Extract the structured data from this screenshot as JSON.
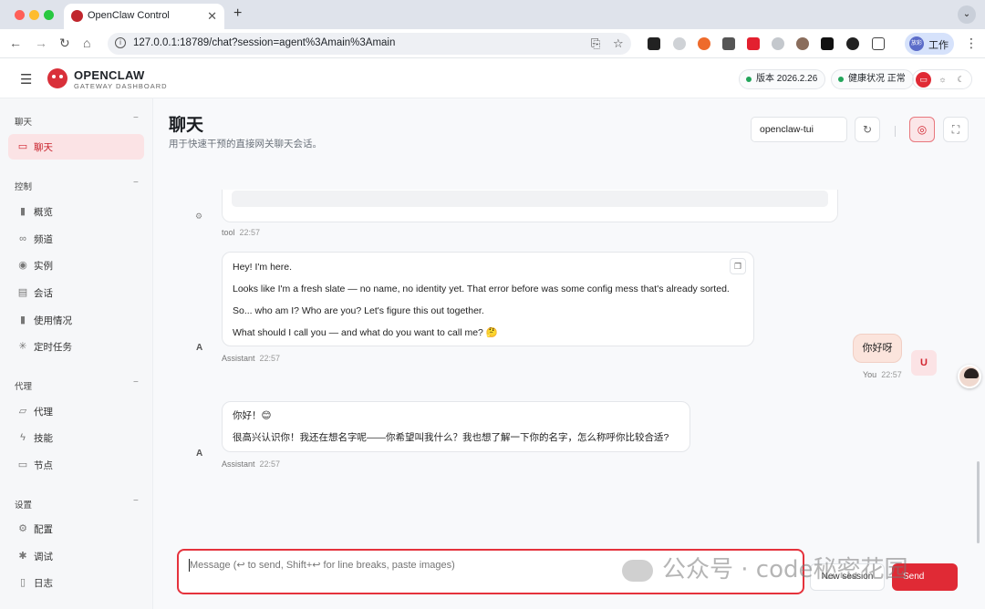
{
  "browser": {
    "tab_title": "OpenClaw Control",
    "url": "127.0.0.1:18789/chat?session=agent%3Amain%3Amain",
    "profile_label": "工作",
    "profile_avatar_text": "放彩"
  },
  "header": {
    "brand": "OPENCLAW",
    "brand_sub": "GATEWAY DASHBOARD",
    "version_label": "版本 2026.2.26",
    "health_label": "健康状况 正常"
  },
  "sidebar": {
    "groups": [
      {
        "title": "聊天",
        "toggle": "−",
        "items": [
          {
            "label": "聊天",
            "icon": "chat-icon",
            "active": true
          }
        ]
      },
      {
        "title": "控制",
        "toggle": "−",
        "items": [
          {
            "label": "概览",
            "icon": "bar-chart-icon"
          },
          {
            "label": "频道",
            "icon": "link-icon"
          },
          {
            "label": "实例",
            "icon": "broadcast-icon"
          },
          {
            "label": "会话",
            "icon": "document-icon"
          },
          {
            "label": "使用情况",
            "icon": "bar-chart-icon"
          },
          {
            "label": "定时任务",
            "icon": "loader-icon"
          }
        ]
      },
      {
        "title": "代理",
        "toggle": "−",
        "items": [
          {
            "label": "代理",
            "icon": "folder-icon"
          },
          {
            "label": "技能",
            "icon": "bolt-icon"
          },
          {
            "label": "节点",
            "icon": "monitor-icon"
          }
        ]
      },
      {
        "title": "设置",
        "toggle": "−",
        "items": [
          {
            "label": "配置",
            "icon": "gear-icon"
          },
          {
            "label": "调试",
            "icon": "bug-icon"
          },
          {
            "label": "日志",
            "icon": "file-icon"
          }
        ]
      }
    ]
  },
  "main": {
    "title": "聊天",
    "subtitle": "用于快速干预的直接网关聊天会话。",
    "session_select": "openclaw-tui"
  },
  "chat": {
    "tool_meta": {
      "role": "tool",
      "time": "22:57"
    },
    "assistant_avatar": "A",
    "message1": {
      "lines": [
        "Hey! I'm here.",
        "Looks like I'm a fresh slate — no name, no identity yet. That error before was some config mess that's already sorted.",
        "So... who am I? Who are you? Let's figure this out together.",
        "What should I call you — and what do you want to call me? 🤔"
      ],
      "role": "Assistant",
      "time": "22:57"
    },
    "user_message": {
      "text": "你好呀",
      "role": "You",
      "time": "22:57",
      "avatar": "U"
    },
    "message2": {
      "lines": [
        "你好！😊",
        "很高兴认识你！我还在想名字呢——你希望叫我什么？我也想了解一下你的名字，怎么称呼你比较合适?"
      ],
      "role": "Assistant",
      "time": "22:57"
    }
  },
  "composer": {
    "placeholder": "Message (↩ to send, Shift+↩ for line breaks, paste images)",
    "new_session_label": "New session",
    "send_label": "Send"
  },
  "watermark": {
    "text": "公众号 · code秘密花园"
  }
}
